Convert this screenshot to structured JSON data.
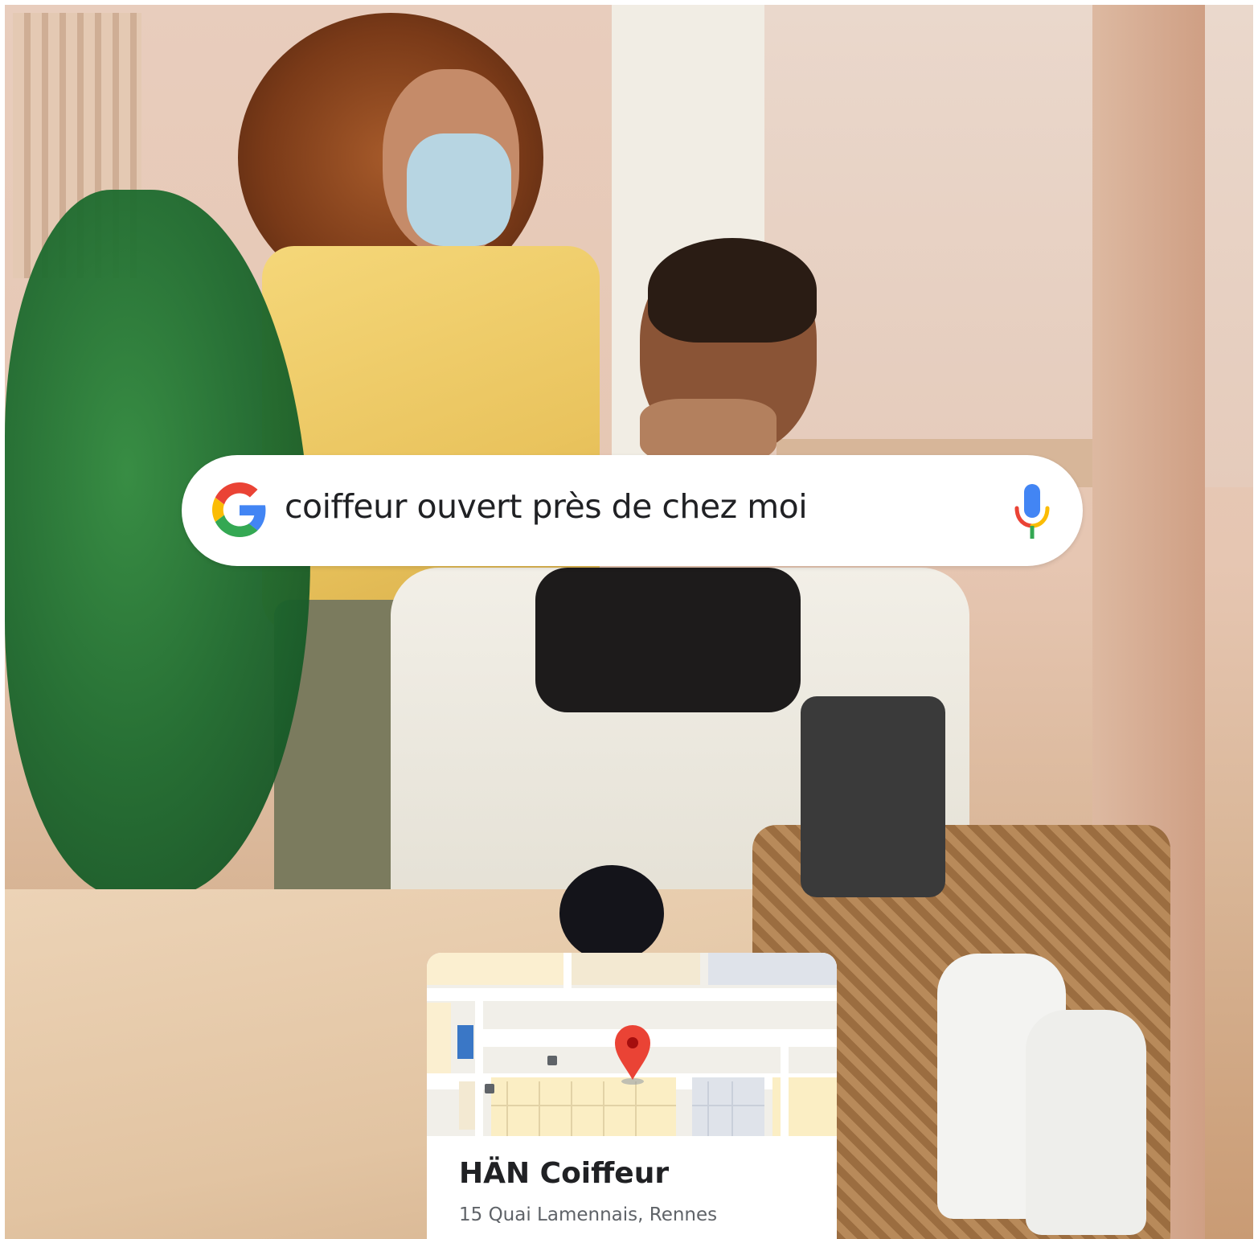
{
  "search": {
    "query": "coiffeur ouvert près de chez moi",
    "logo_icon": "google-g-icon",
    "voice_icon": "microphone-icon"
  },
  "result_card": {
    "name": "HÄN Coiffeur",
    "address": "15 Quai Lamennais, Rennes",
    "map_pin_color": "#ea4335"
  },
  "brand_colors": {
    "blue": "#4285f4",
    "red": "#ea4335",
    "yellow": "#fbbc05",
    "green": "#34a853"
  }
}
